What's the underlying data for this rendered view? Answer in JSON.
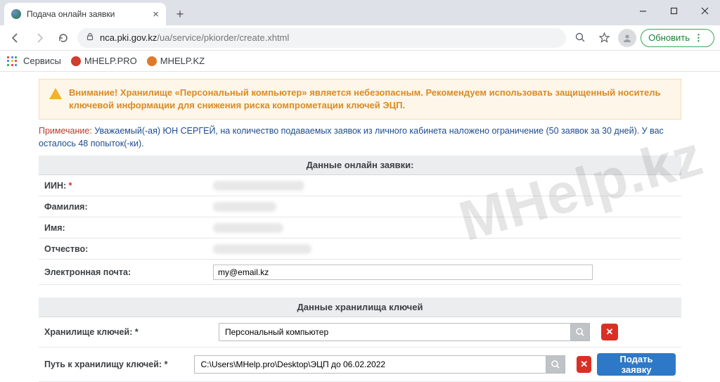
{
  "browser": {
    "tab_title": "Подача онлайн заявки",
    "url_host": "nca.pki.gov.kz",
    "url_path": "/ua/service/pkiorder/create.xhtml",
    "update_label": "Обновить"
  },
  "bookmarks": {
    "services": "Сервисы",
    "item1": "MHELP.PRO",
    "item2": "MHELP.KZ"
  },
  "watermark": "MHelp.kz",
  "alert": {
    "text": "Внимание! Хранилище «Персональный компьютер» является небезопасным. Рекомендуем использовать защищенный носитель ключевой информации для снижения риска компрометации ключей ЭЦП."
  },
  "note": {
    "label": "Примечание:",
    "body": "Уважаемый(-ая) ЮН СЕРГЕЙ, на количество подаваемых заявок из личного кабинета наложено ограничение (50 заявок за 30 дней). У вас осталось 48 попыток(-ки)."
  },
  "section1": {
    "title": "Данные онлайн заявки:",
    "fields": {
      "iin_label": "ИИН:",
      "lastname_label": "Фамилия:",
      "firstname_label": "Имя:",
      "middlename_label": "Отчество:",
      "email_label": "Электронная почта:",
      "email_value": "my@email.kz"
    }
  },
  "section2": {
    "title": "Данные хранилища ключей",
    "store_label": "Хранилище ключей:",
    "store_value": "Персональный компьютер",
    "path_label": "Путь к хранилищу ключей:",
    "path_value": "C:\\Users\\MHelp.pro\\Desktop\\ЭЦП до 06.02.2022",
    "submit_label": "Подать заявку"
  }
}
